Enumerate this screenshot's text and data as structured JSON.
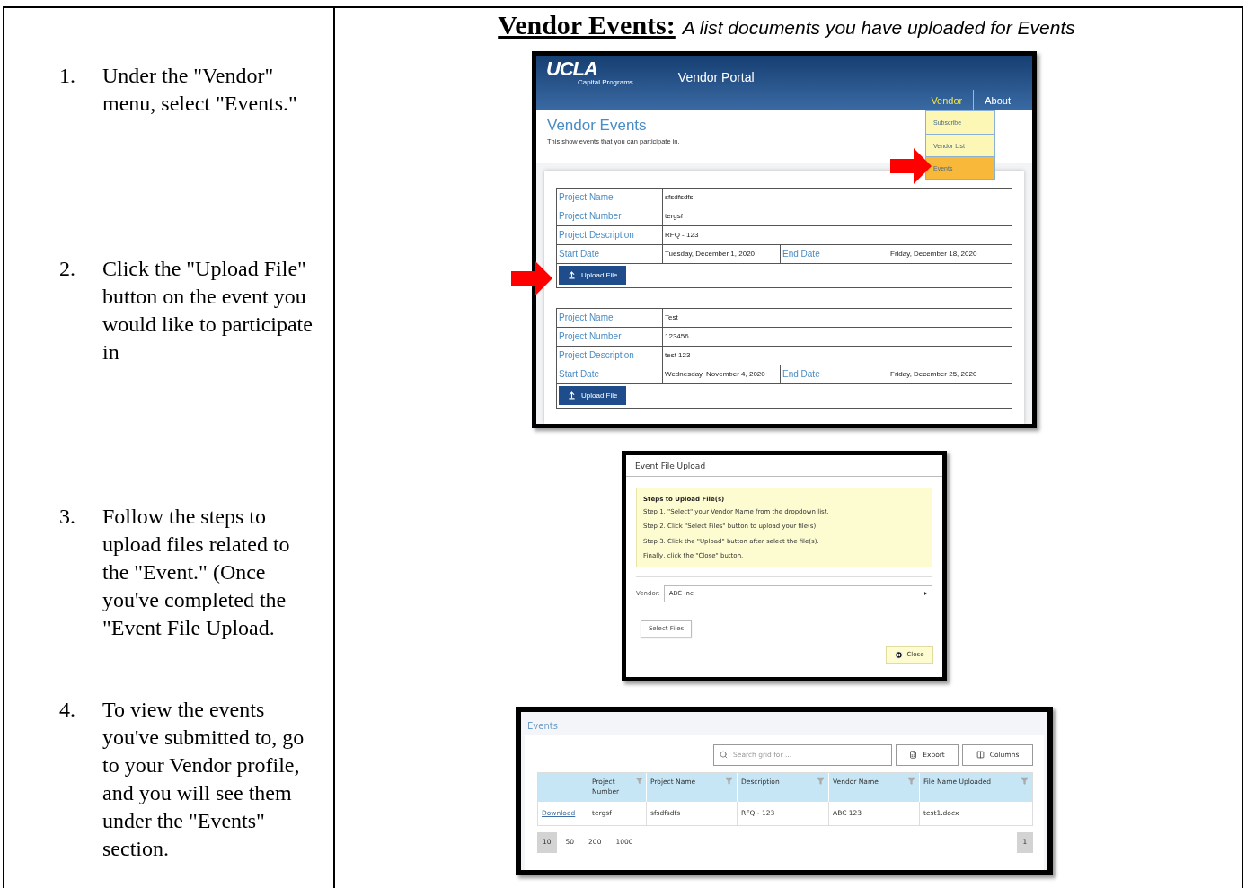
{
  "steps": [
    {
      "number": "1.",
      "text": "Under the \"Vendor\" menu, select \"Events.\""
    },
    {
      "number": "2.",
      "text": "Click the \"Upload File\" button on the event you would like to participate in"
    },
    {
      "number": "3.",
      "text": "Follow the steps to upload files related to the \"Event.\" (Once you've completed the \"Event File Upload."
    },
    {
      "number": "4.",
      "text": "To view the events you've submitted to, go to your Vendor profile, and you will see them under the \"Events\" section."
    }
  ],
  "heading": {
    "title": "Vendor Events:",
    "subtitle": "A list documents you have uploaded for Events"
  },
  "portal": {
    "logo": "UCLA",
    "logo_sub": "Capital Programs",
    "app_title": "Vendor Portal",
    "nav": [
      {
        "label": "Vendor",
        "selected": true
      },
      {
        "label": "About",
        "selected": false
      }
    ],
    "menu": [
      {
        "label": "Subscribe",
        "selected": false
      },
      {
        "label": "Vendor List",
        "selected": false
      },
      {
        "label": "Events",
        "selected": true
      }
    ],
    "page_title": "Vendor Events",
    "page_subtitle": "This show events that you can participate in.",
    "events": [
      {
        "rows": [
          {
            "label": "Project Name",
            "value": "sfsdfsdfs"
          },
          {
            "label": "Project Number",
            "value": "tergsf"
          },
          {
            "label": "Project Description",
            "value": "RFQ - 123"
          }
        ],
        "start_label": "Start Date",
        "start": "Tuesday, December 1, 2020",
        "end_label": "End Date",
        "end": "Friday, December 18, 2020",
        "button": "Upload File"
      },
      {
        "rows": [
          {
            "label": "Project Name",
            "value": "Test"
          },
          {
            "label": "Project Number",
            "value": "123456"
          },
          {
            "label": "Project Description",
            "value": "test 123"
          }
        ],
        "start_label": "Start Date",
        "start": "Wednesday, November 4, 2020",
        "end_label": "End Date",
        "end": "Friday, December 25, 2020",
        "button": "Upload File"
      }
    ]
  },
  "dialog": {
    "title": "Event File Upload",
    "steps_heading": "Steps to Upload File(s)",
    "steps": [
      "Step 1. \"Select\" your Vendor Name from the dropdown list.",
      "Step 2. Click \"Select Files\" button to upload your file(s).",
      "Step 3. Click the \"Upload\" button after select the file(s).",
      "Finally, click the \"Close\" button."
    ],
    "vendor_label": "Vendor:",
    "vendor_value": "ABC Inc",
    "select_button": "Select Files",
    "close_button": "Close"
  },
  "grid": {
    "title": "Events",
    "search_placeholder": "Search grid for ...",
    "export": "Export",
    "columns_button": "Columns",
    "columns": [
      "",
      "Project Number",
      "Project Name",
      "Description",
      "Vendor Name",
      "File Name Uploaded"
    ],
    "rows": [
      [
        "Download",
        "tergsf",
        "sfsdfsdfs",
        "RFQ - 123",
        "ABC 123",
        "test1.docx"
      ]
    ],
    "page_sizes": [
      {
        "label": "10",
        "selected": true
      },
      {
        "label": "50",
        "selected": false
      },
      {
        "label": "200",
        "selected": false
      },
      {
        "label": "1000",
        "selected": false
      }
    ],
    "pages": [
      {
        "label": "1",
        "selected": true
      }
    ]
  }
}
